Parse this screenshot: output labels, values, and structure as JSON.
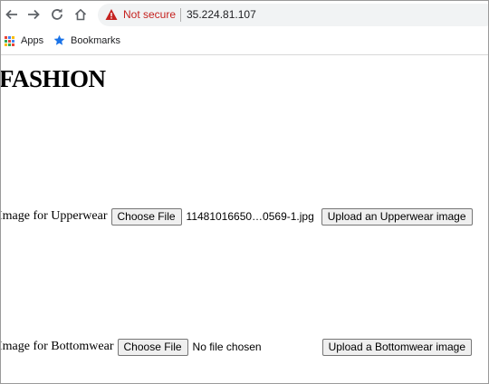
{
  "browser": {
    "not_secure_label": "Not secure",
    "url": "35.224.81.107",
    "bookmarks": [
      {
        "label": "Apps",
        "icon": "apps-grid-icon"
      },
      {
        "label": "Bookmarks",
        "icon": "star-icon"
      }
    ],
    "colors": {
      "warning": "#c5221f",
      "bookmark_star": "#1a73e8"
    }
  },
  "page": {
    "title": "FASHION",
    "upper_form": {
      "label": "Image for Upperwear",
      "choose_label": "Choose File",
      "file_name": "11481016650…0569-1.jpg",
      "upload_label": "Upload an Upperwear image"
    },
    "bottom_form": {
      "label": "Image for Bottomwear",
      "choose_label": "Choose File",
      "file_name": "No file chosen",
      "upload_label": "Upload a Bottomwear image"
    }
  }
}
